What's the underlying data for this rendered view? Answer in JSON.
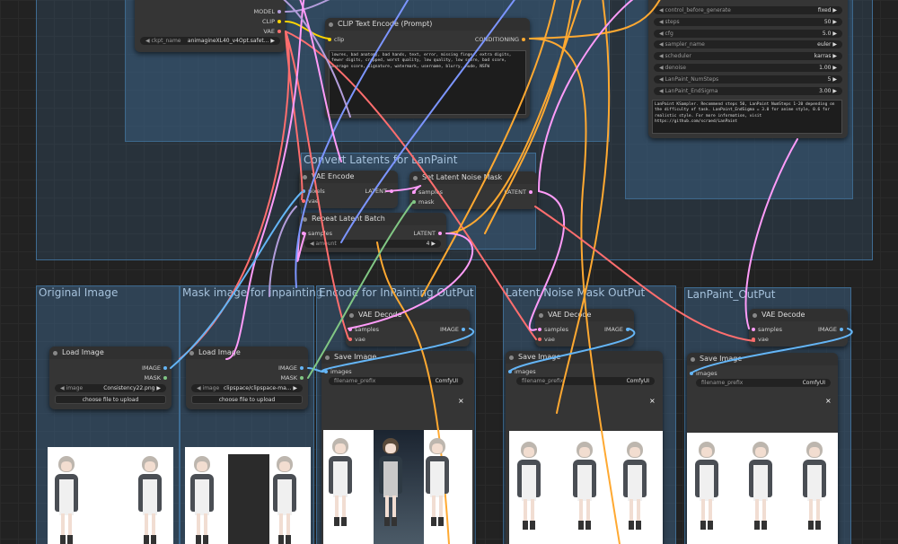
{
  "groups": {
    "convert": "Convert Latents for LanPaint",
    "original": "Original Image",
    "mask": "Mask image for inpainting",
    "encode": "Encode for InPainting OutPut",
    "latent_noise": "Latent Noise Mask OutPut",
    "lanpaint": "LanPaint_OutPut"
  },
  "checkpoint": {
    "outputs": [
      "MODEL",
      "CLIP",
      "VAE"
    ],
    "ckpt_label": "ckpt_name",
    "ckpt_value": "animagineXL40_v4Opt.safet..."
  },
  "clip_encode": {
    "title": "CLIP Text Encode (Prompt)",
    "input": "clip",
    "output": "CONDITIONING",
    "text": "lowres, bad anatomy, bad hands, text, error, missing finger, extra digits, fewer digits, cropped, worst quality, low quality, low score, bad score, average score, signature, watermark, username, blurry, nude, NSFW"
  },
  "sampler": {
    "widgets": [
      {
        "label": "control_before_generate",
        "value": "fixed"
      },
      {
        "label": "steps",
        "value": "50"
      },
      {
        "label": "cfg",
        "value": "5.0"
      },
      {
        "label": "sampler_name",
        "value": "euler"
      },
      {
        "label": "scheduler",
        "value": "karras"
      },
      {
        "label": "denoise",
        "value": "1.00"
      },
      {
        "label": "LanPaint_NumSteps",
        "value": "5"
      },
      {
        "label": "LanPaint_EndSigma",
        "value": "3.00"
      }
    ],
    "note": "LanPaint KSampler. Recommend steps 50, LanPaint NumSteps 1-20 depending on the difficulty of task. LanPaint_EndSigma = 3.0 for anime style, 0.6 for realistic style. For more information, visit https://github.com/scraed/LanPaint"
  },
  "vae_encode": {
    "title": "VAE Encode",
    "inputs": [
      "pixels",
      "vae"
    ],
    "output": "LATENT"
  },
  "set_noise_mask": {
    "title": "Set Latent Noise Mask",
    "inputs": [
      "samples",
      "mask"
    ],
    "output": "LATENT"
  },
  "repeat_batch": {
    "title": "Repeat Latent Batch",
    "input": "samples",
    "output": "LATENT",
    "amount_label": "amount",
    "amount_value": "4"
  },
  "load_image_1": {
    "title": "Load Image",
    "outputs": [
      "IMAGE",
      "MASK"
    ],
    "image_label": "image",
    "image_value": "Consistency22.png",
    "button": "choose file to upload"
  },
  "load_image_2": {
    "title": "Load Image",
    "outputs": [
      "IMAGE",
      "MASK"
    ],
    "image_label": "image",
    "image_value": "clipspace/clipspace-ma...",
    "button": "choose file to upload"
  },
  "vae_decode_1": {
    "title": "VAE Decode",
    "inputs": [
      "samples",
      "vae"
    ],
    "output": "IMAGE"
  },
  "vae_decode_2": {
    "title": "VAE Decode",
    "inputs": [
      "samples",
      "vae"
    ],
    "output": "IMAGE"
  },
  "vae_decode_3": {
    "title": "VAE Decode",
    "inputs": [
      "samples",
      "vae"
    ],
    "output": "IMAGE"
  },
  "save_image_1": {
    "title": "Save Image",
    "input": "images",
    "prefix_label": "filename_prefix",
    "prefix_value": "ComfyUI",
    "close": "×"
  },
  "save_image_2": {
    "title": "Save Image",
    "input": "images",
    "prefix_label": "filename_prefix",
    "prefix_value": "ComfyUI",
    "close": "×"
  },
  "save_image_3": {
    "title": "Save Image",
    "input": "images",
    "prefix_label": "filename_prefix",
    "prefix_value": "ComfyUI",
    "close": "×"
  },
  "colors": {
    "model": "#b39ddb",
    "clip": "#ffd500",
    "vae": "#ff6e6e",
    "conditioning": "#ffa931",
    "latent": "#ff9cf9",
    "image": "#64b5f6",
    "mask": "#81c784",
    "group": "#3f6c92"
  }
}
